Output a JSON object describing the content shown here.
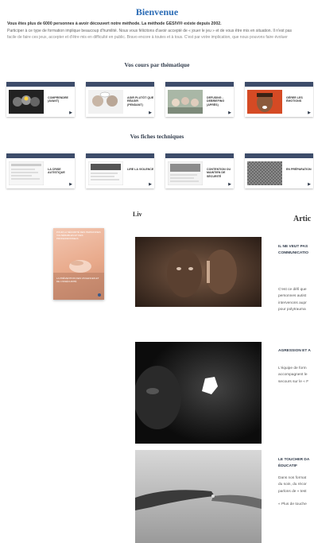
{
  "header": {
    "title": "Bienvenue",
    "intro_bold": "Vous êtes plus de 6000 personnes à avoir découvert notre méthode. La méthode GESIVI® existe depuis 2002.",
    "intro_line2": "Participer à ce type de formation implique beaucoup d'humilité. Nous vous félicitons d'avoir accepté de « jouer le jeu » et de vous être mis en situation. Il n'est pas",
    "intro_line3": "facile de faire ces jeux, accepter et d'être mis en difficulté en public. Bravo encore à toutes et à tous. C'est par votre implication, que nous pouvons faire évoluer"
  },
  "cours": {
    "title": "Vos cours par thématique",
    "cards": [
      {
        "label": "Comprendre (avant)"
      },
      {
        "label": "Agir plutôt que réagir (pendant)"
      },
      {
        "label": "Defusing - Debriefing (après)"
      },
      {
        "label": "Gérer les émotions"
      }
    ]
  },
  "fiches": {
    "title": "Vos fiches techniques",
    "cards": [
      {
        "label": "La crise autistique"
      },
      {
        "label": "Lire la violence"
      },
      {
        "label": "Contention ou Maintien de sécurité"
      },
      {
        "label": "En préparation"
      }
    ]
  },
  "livre": {
    "title": "Liv",
    "cover_text": "POUR LA SÉCURITÉ DES PERSONNES VULNÉRABLES ET DES PROFESSIONNELS",
    "cover_sub": "LA PRÉVENTION DES VIOLENCES ET DE L'INSÉCURITÉ"
  },
  "articles": {
    "title": "Artic",
    "items": [
      {
        "title_lines": [
          "IL NE VEUT PAS",
          "COMMUNICATIO"
        ],
        "text_lines": [
          "C'est ce défi que",
          "personnes autist",
          "intervenons aupr",
          "pour polytrauma"
        ]
      },
      {
        "title_lines": [
          "AGRESSION ET A"
        ],
        "text_lines": [
          "L'équipe de form",
          "accompagnent le",
          "secours sur le « F"
        ]
      },
      {
        "title_lines": [
          "LE TOUCHER DA",
          "ÉDUCATIF"
        ],
        "text_lines": [
          "Dans nos format",
          "du soin, du récor",
          "parlons de « test",
          "",
          "« Plus de touche"
        ]
      }
    ]
  },
  "colors": {
    "accent": "#2a6bb5",
    "card_bar": "#3d4c6a"
  }
}
